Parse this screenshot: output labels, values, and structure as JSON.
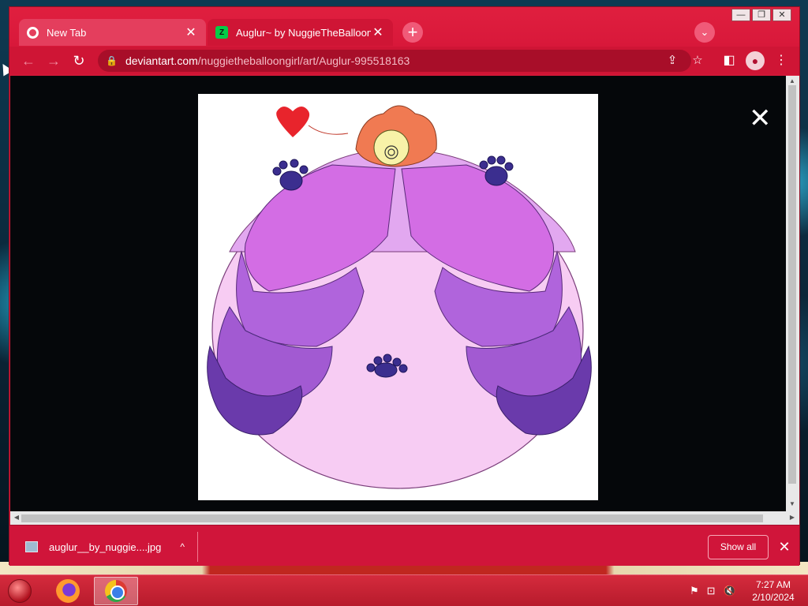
{
  "browser": {
    "tabs": [
      {
        "title": "New Tab",
        "close": "✕"
      },
      {
        "title": "Auglur~ by NuggieTheBalloonGi",
        "close": "✕"
      }
    ],
    "new_tab_glyph": "+",
    "tab_search_glyph": "⌄",
    "window_controls": [
      "—",
      "❐",
      "✕"
    ],
    "nav": {
      "back": "←",
      "forward": "→",
      "reload": "↻"
    },
    "address": {
      "lock": "🔒",
      "host": "deviantart.com",
      "path": "/nuggietheballoongirl/art/Auglur-995518163"
    },
    "toolbar_icons": {
      "share": "⇪",
      "bookmark": "☆",
      "side_panel": "◧",
      "profile": "●",
      "menu": "⋮"
    }
  },
  "viewer": {
    "close_glyph": "✕",
    "artwork": {
      "colors": {
        "body": "#f7ccf3",
        "wing_light": "#d36de4",
        "wing_mid": "#a25ad2",
        "wing_dark": "#6a3aab",
        "crest": "#f07a52",
        "heart": "#e8242c",
        "paw": "#3b2e8f"
      }
    }
  },
  "download_shelf": {
    "items": [
      {
        "filename": "auglur__by_nuggie....jpg",
        "caret": "^"
      }
    ],
    "show_all_label": "Show all",
    "close_glyph": "✕"
  },
  "taskbar": {
    "apps": [
      "firefox",
      "chrome"
    ],
    "tray_icons": [
      "flag-icon",
      "network-icon",
      "volume-muted-icon"
    ],
    "clock": {
      "time": "7:27 AM",
      "date": "2/10/2024"
    }
  }
}
